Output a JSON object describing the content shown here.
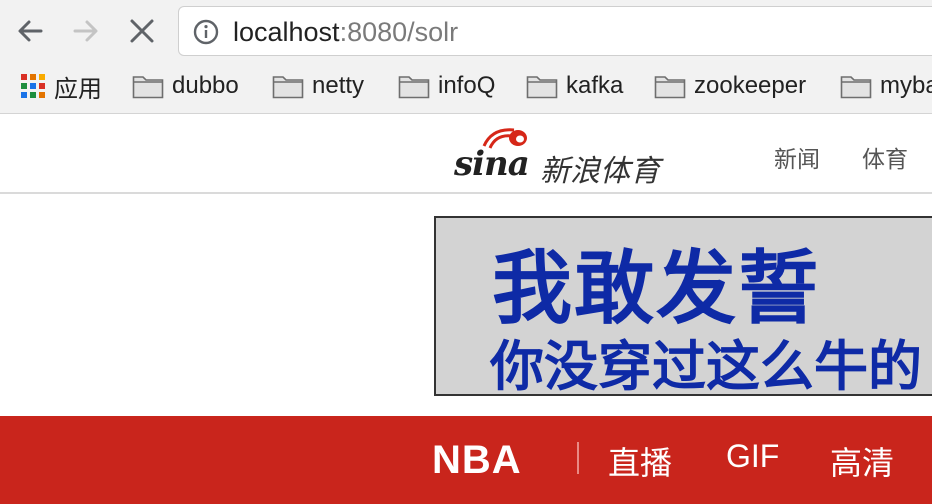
{
  "browser": {
    "url_host": "localhost",
    "url_path": ":8080/solr",
    "bookmarks": [
      {
        "label": "应用",
        "icon": "apps-grid-icon"
      },
      {
        "label": "dubbo",
        "icon": "folder-icon"
      },
      {
        "label": "netty",
        "icon": "folder-icon"
      },
      {
        "label": "infoQ",
        "icon": "folder-icon"
      },
      {
        "label": "kafka",
        "icon": "folder-icon"
      },
      {
        "label": "zookeeper",
        "icon": "folder-icon"
      },
      {
        "label": "myba",
        "icon": "folder-icon"
      }
    ]
  },
  "site": {
    "logo_text": "sina",
    "logo_cn": "新浪体育",
    "nav": [
      "新闻",
      "体育"
    ]
  },
  "ad": {
    "line1": "我敢发誓",
    "line2": "你没穿过这么牛的"
  },
  "redbar": {
    "nba": "NBA",
    "items": [
      "直播",
      "GIF",
      "高清"
    ]
  },
  "colors": {
    "accent_red": "#c9251c",
    "ad_blue": "#0e2aa6"
  }
}
